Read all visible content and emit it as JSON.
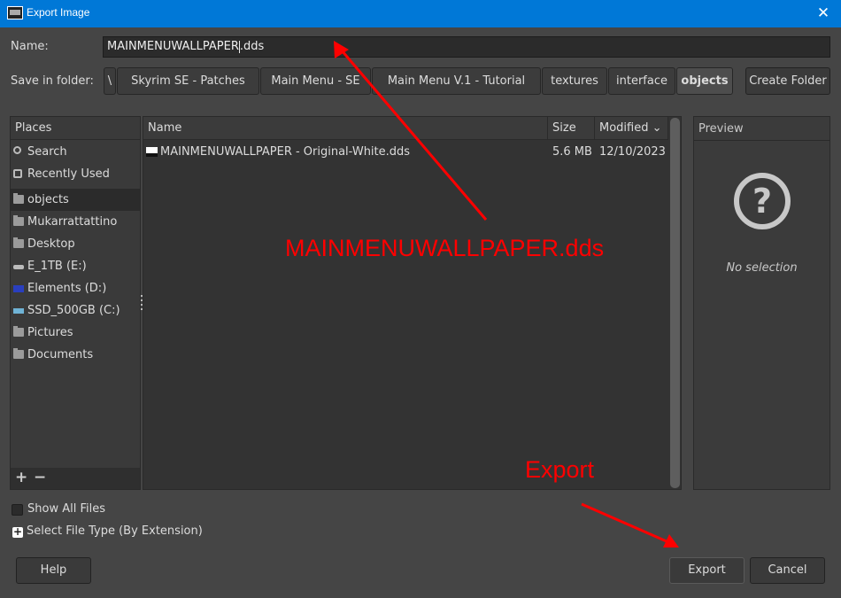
{
  "window": {
    "title": "Export Image",
    "close_glyph": "✕"
  },
  "name_field": {
    "label": "Name:",
    "value_before_cursor": "MAINMENUWALLPAPER",
    "value_after_cursor": ".dds"
  },
  "save_in_folder": {
    "label": "Save in folder:",
    "breadcrumbs": [
      "\\",
      "Skyrim SE - Patches",
      "Main Menu - SE",
      "Main Menu V.1 - Tutorial",
      "textures",
      "interface",
      "objects"
    ],
    "create_folder_label": "Create Folder"
  },
  "places": {
    "header": "Places",
    "items": [
      {
        "label": "Search",
        "icon": "search-icon"
      },
      {
        "label": "Recently Used",
        "icon": "recently-used-icon"
      },
      {
        "label": "objects",
        "icon": "folder-icon",
        "selected": true
      },
      {
        "label": "Mukarrattattino",
        "icon": "folder-icon"
      },
      {
        "label": "Desktop",
        "icon": "folder-icon"
      },
      {
        "label": "E_1TB (E:)",
        "icon": "drive-icon"
      },
      {
        "label": "Elements (D:)",
        "icon": "wd-drive-icon"
      },
      {
        "label": "SSD_500GB (C:)",
        "icon": "ssd-drive-icon"
      },
      {
        "label": "Pictures",
        "icon": "folder-icon"
      },
      {
        "label": "Documents",
        "icon": "folder-icon"
      }
    ],
    "add_glyph": "+",
    "remove_glyph": "−"
  },
  "file_list": {
    "columns": {
      "name": "Name",
      "size": "Size",
      "modified": "Modified"
    },
    "sort_glyph": "⌄",
    "rows": [
      {
        "name": "MAINMENUWALLPAPER - Original-White.dds",
        "size": "5.6 MB",
        "modified": "12/10/2023"
      }
    ]
  },
  "preview": {
    "header": "Preview",
    "glyph": "?",
    "no_selection": "No selection"
  },
  "options": {
    "show_all_files": "Show All Files",
    "select_file_type": "Select File Type (By Extension)",
    "expander_glyph": "+"
  },
  "buttons": {
    "help": "Help",
    "export": "Export",
    "cancel": "Cancel"
  },
  "annotations": {
    "filename_callout": "MAINMENUWALLPAPER.dds",
    "export_callout": "Export",
    "color": "#ff0000"
  }
}
